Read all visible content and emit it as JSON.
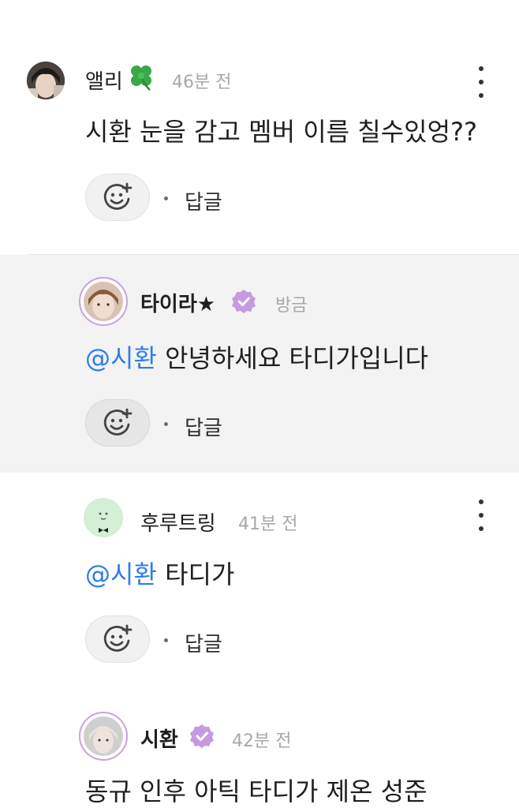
{
  "comments": [
    {
      "author": "앨리",
      "time": "46분 전",
      "text": "시환 눈을 감고 멤버 이름 칠수있엉??",
      "reply_label": "답글",
      "avatar_icon": "user-photo-avatar",
      "emoji_icon": "four-leaf-clover-icon"
    },
    {
      "author": "타이라★",
      "time": "방금",
      "mention": "@시환",
      "text": " 안녕하세요 타디가입니다",
      "reply_label": "답글",
      "verified": true
    },
    {
      "author": "후루트링",
      "time": "41분 전",
      "mention": "@시환",
      "text": " 타디가",
      "reply_label": "답글"
    },
    {
      "author": "시환",
      "time": "42분 전",
      "text": "동규 인후 아틱 타디가 제온 성준",
      "verified": true
    }
  ],
  "colors": {
    "mention": "#2f7de8",
    "verified_badge": "#c49be0",
    "highlight_background": "#f3f3f3",
    "avatar_ring": "#c9a2e0"
  }
}
